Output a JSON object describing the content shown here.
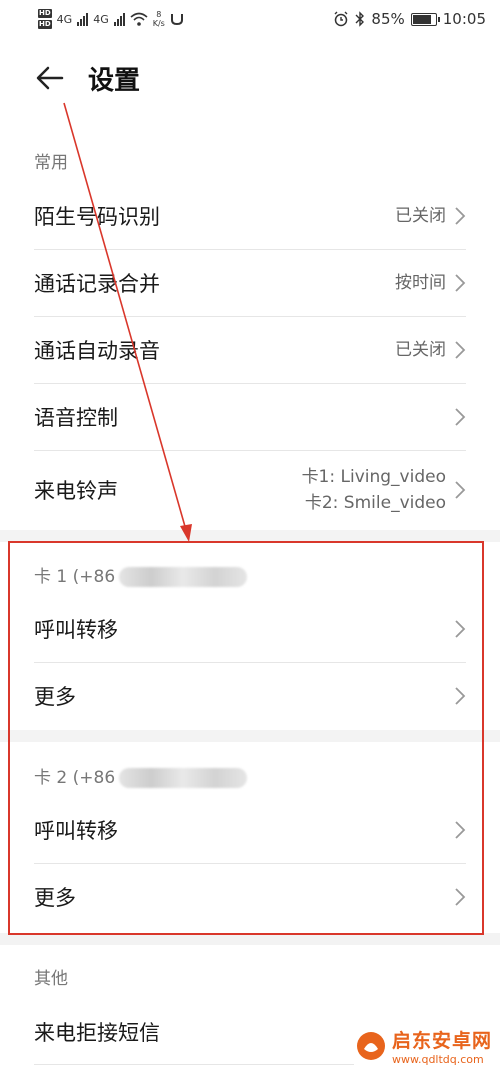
{
  "status_bar": {
    "hd1": "HD",
    "hd2": "HD",
    "net1": "4G",
    "net2": "4G",
    "speed_value": "8",
    "speed_unit": "K/s",
    "battery_percent": "85%",
    "battery_level": 0.85,
    "time": "10:05"
  },
  "header": {
    "title": "设置"
  },
  "sections": {
    "common": {
      "label": "常用",
      "items": [
        {
          "label": "陌生号码识别",
          "value": "已关闭"
        },
        {
          "label": "通话记录合并",
          "value": "按时间"
        },
        {
          "label": "通话自动录音",
          "value": "已关闭"
        },
        {
          "label": "语音控制",
          "value": ""
        },
        {
          "label": "来电铃声",
          "value_line1": "卡1: Living_video",
          "value_line2": "卡2: Smile_video"
        }
      ]
    },
    "card1": {
      "label": "卡 1 (+86",
      "items": [
        {
          "label": "呼叫转移"
        },
        {
          "label": "更多"
        }
      ]
    },
    "card2": {
      "label": "卡 2 (+86",
      "items": [
        {
          "label": "呼叫转移"
        },
        {
          "label": "更多"
        }
      ]
    },
    "other": {
      "label": "其他",
      "items": [
        {
          "label": "来电拒接短信"
        }
      ]
    }
  },
  "watermark": {
    "title": "启东安卓网",
    "url": "www.qdltdq.com"
  },
  "colors": {
    "annotation_red": "#d9372b",
    "watermark_orange": "#e8641c"
  }
}
